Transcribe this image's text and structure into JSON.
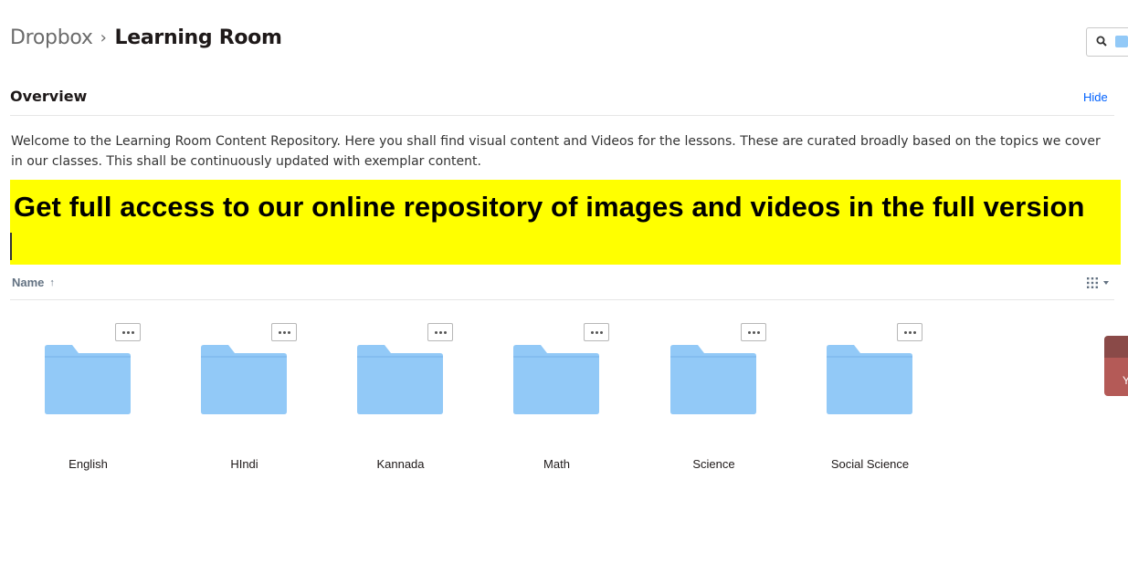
{
  "breadcrumb": {
    "root": "Dropbox",
    "separator": "›",
    "current": "Learning Room"
  },
  "search": {
    "icon": "search-icon",
    "folder_icon": "folder-icon"
  },
  "overview": {
    "title": "Overview",
    "hide_label": "Hide",
    "description": "Welcome to the Learning Room Content Repository. Here you shall find visual content and Videos for the lessons. These are curated broadly based on the topics we cover in our classes. This shall be continuously updated with exemplar content."
  },
  "promo": {
    "text": "Get full access to our online repository of images and videos in the full version"
  },
  "list_header": {
    "name_label": "Name",
    "sort_arrow": "↑",
    "view_icon": "grid-view-icon"
  },
  "folders": [
    {
      "name": "English"
    },
    {
      "name": "HIndi"
    },
    {
      "name": "Kannada"
    },
    {
      "name": "Math"
    },
    {
      "name": "Science"
    },
    {
      "name": "Social Science"
    }
  ],
  "side_tab": {
    "label": "Y"
  },
  "colors": {
    "accent": "#0061fe",
    "folder": "#92c9f7",
    "promo_bg": "#ffff00",
    "side_tab_top": "#8a4a48",
    "side_tab_bottom": "#b45a57"
  }
}
